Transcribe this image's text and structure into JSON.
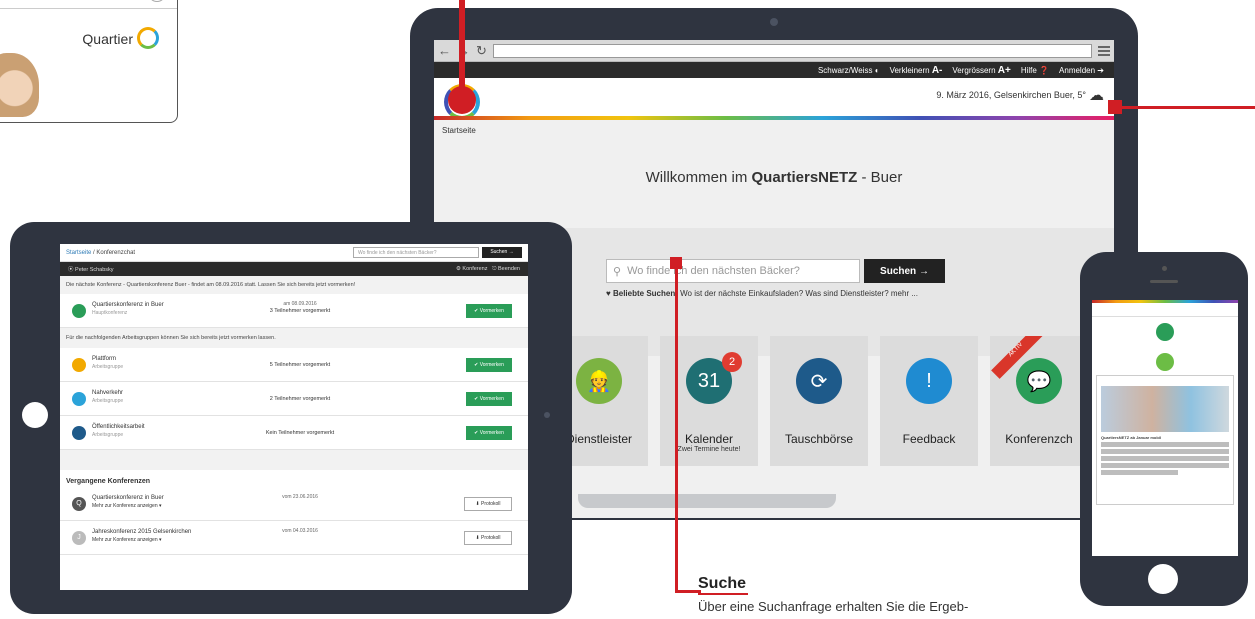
{
  "fragment": {
    "quartier_label": "Quartier"
  },
  "laptop": {
    "topnav": {
      "schwarzweiss": "Schwarz/Weiss",
      "verkleinern": "Verkleinern",
      "verkleinern_sym": "A-",
      "vergroessern": "Vergrössern",
      "vergroessern_sym": "A+",
      "hilfe": "Hilfe",
      "anmelden": "Anmelden"
    },
    "dateline": "9. März 2016,  Gelsenkirchen Buer, 5°",
    "breadcrumb": "Startseite",
    "welcome_prefix": "Willkommen im ",
    "welcome_brand": "QuartiersNETZ",
    "welcome_suffix": " - Buer",
    "search_placeholder": "Wo finde ich den nächsten Bäcker?",
    "search_button": "Suchen",
    "popular_label": "Beliebte Suchen:",
    "popular_text": " Wo ist der nächste Einkaufsladen? Was sind Dienstleister? mehr ...",
    "tiles": [
      {
        "label": "Dienstleister",
        "sub": "",
        "color": "#7cb342",
        "icon": "worker-icon"
      },
      {
        "label": "Kalender",
        "sub": "Zwei Termine heute!",
        "color": "#1f6f73",
        "icon": "calendar-icon",
        "calendar_day": "31",
        "badge": "2"
      },
      {
        "label": "Tauschbörse",
        "sub": "",
        "color": "#1e5a8a",
        "icon": "exchange-icon"
      },
      {
        "label": "Feedback",
        "sub": "",
        "color": "#1f8bd1",
        "icon": "feedback-icon"
      },
      {
        "label": "Konferenzch",
        "sub": "",
        "color": "#2a9d58",
        "icon": "chat-icon",
        "ribbon": "AKTIV"
      }
    ]
  },
  "tablet": {
    "breadcrumb_home": "Startseite",
    "breadcrumb_sep": " / ",
    "breadcrumb_current": "Konferenzchat",
    "search_placeholder": "Wo finde ich den nächsten Bäcker?",
    "search_button": "Suchen →",
    "user": "Peter Schabsky",
    "konferenz": "Konferenz",
    "beenden": "Beenden",
    "note": "Die nächste Konferenz - Quartierskonferenz Buer - findet am 08.09.2016 statt. Lassen Sie sich bereits jetzt vormerken!",
    "main_row": {
      "name": "Quartierskonferenz in Buer",
      "sub": "Hauptkonferenz",
      "date": "am 08.09.2016",
      "count": "3 Teilnehmer vorgemerkt",
      "button": "✔ Vormerken"
    },
    "groups_note": "Für die nachfolgenden Arbeitsgruppen können Sie sich bereits jetzt vormerken lassen.",
    "groups": [
      {
        "name": "Plattform",
        "sub": "Arbeitsgruppe",
        "count": "5 Teilnehmer vorgemerkt",
        "button": "✔ Vormerken",
        "color": "#f2a900"
      },
      {
        "name": "Nahverkehr",
        "sub": "Arbeitsgruppe",
        "count": "2 Teilnehmer vorgemerkt",
        "button": "✔ Vormerken",
        "color": "#2ba3d9"
      },
      {
        "name": "Öffentlichkeitsarbeit",
        "sub": "Arbeitsgruppe",
        "count": "Kein Teilnehmer vorgemerkt",
        "button": "✔ Vormerken",
        "color": "#1e5a8a"
      }
    ],
    "past_title": "Vergangene Konferenzen",
    "past": [
      {
        "initial": "Q",
        "name": "Quartierskonferenz in Buer",
        "sub": "Mehr zur Konferenz anzeigen ▾",
        "date": "vom 23.06.2016",
        "button": "⬇ Protokoll"
      },
      {
        "initial": "J",
        "name": "Jahreskonferenz 2015 Gelsenkirchen",
        "sub": "Mehr zur Konferenz anzeigen ▾",
        "date": "vom 04.03.2016",
        "button": "⬇ Protokoll"
      }
    ]
  },
  "phone": {
    "card_title": "QuartiersNETZ ab Januar mobil"
  },
  "annotation": {
    "title": "Suche",
    "text": "Über eine Suchanfrage erhalten Sie die Ergeb-"
  }
}
